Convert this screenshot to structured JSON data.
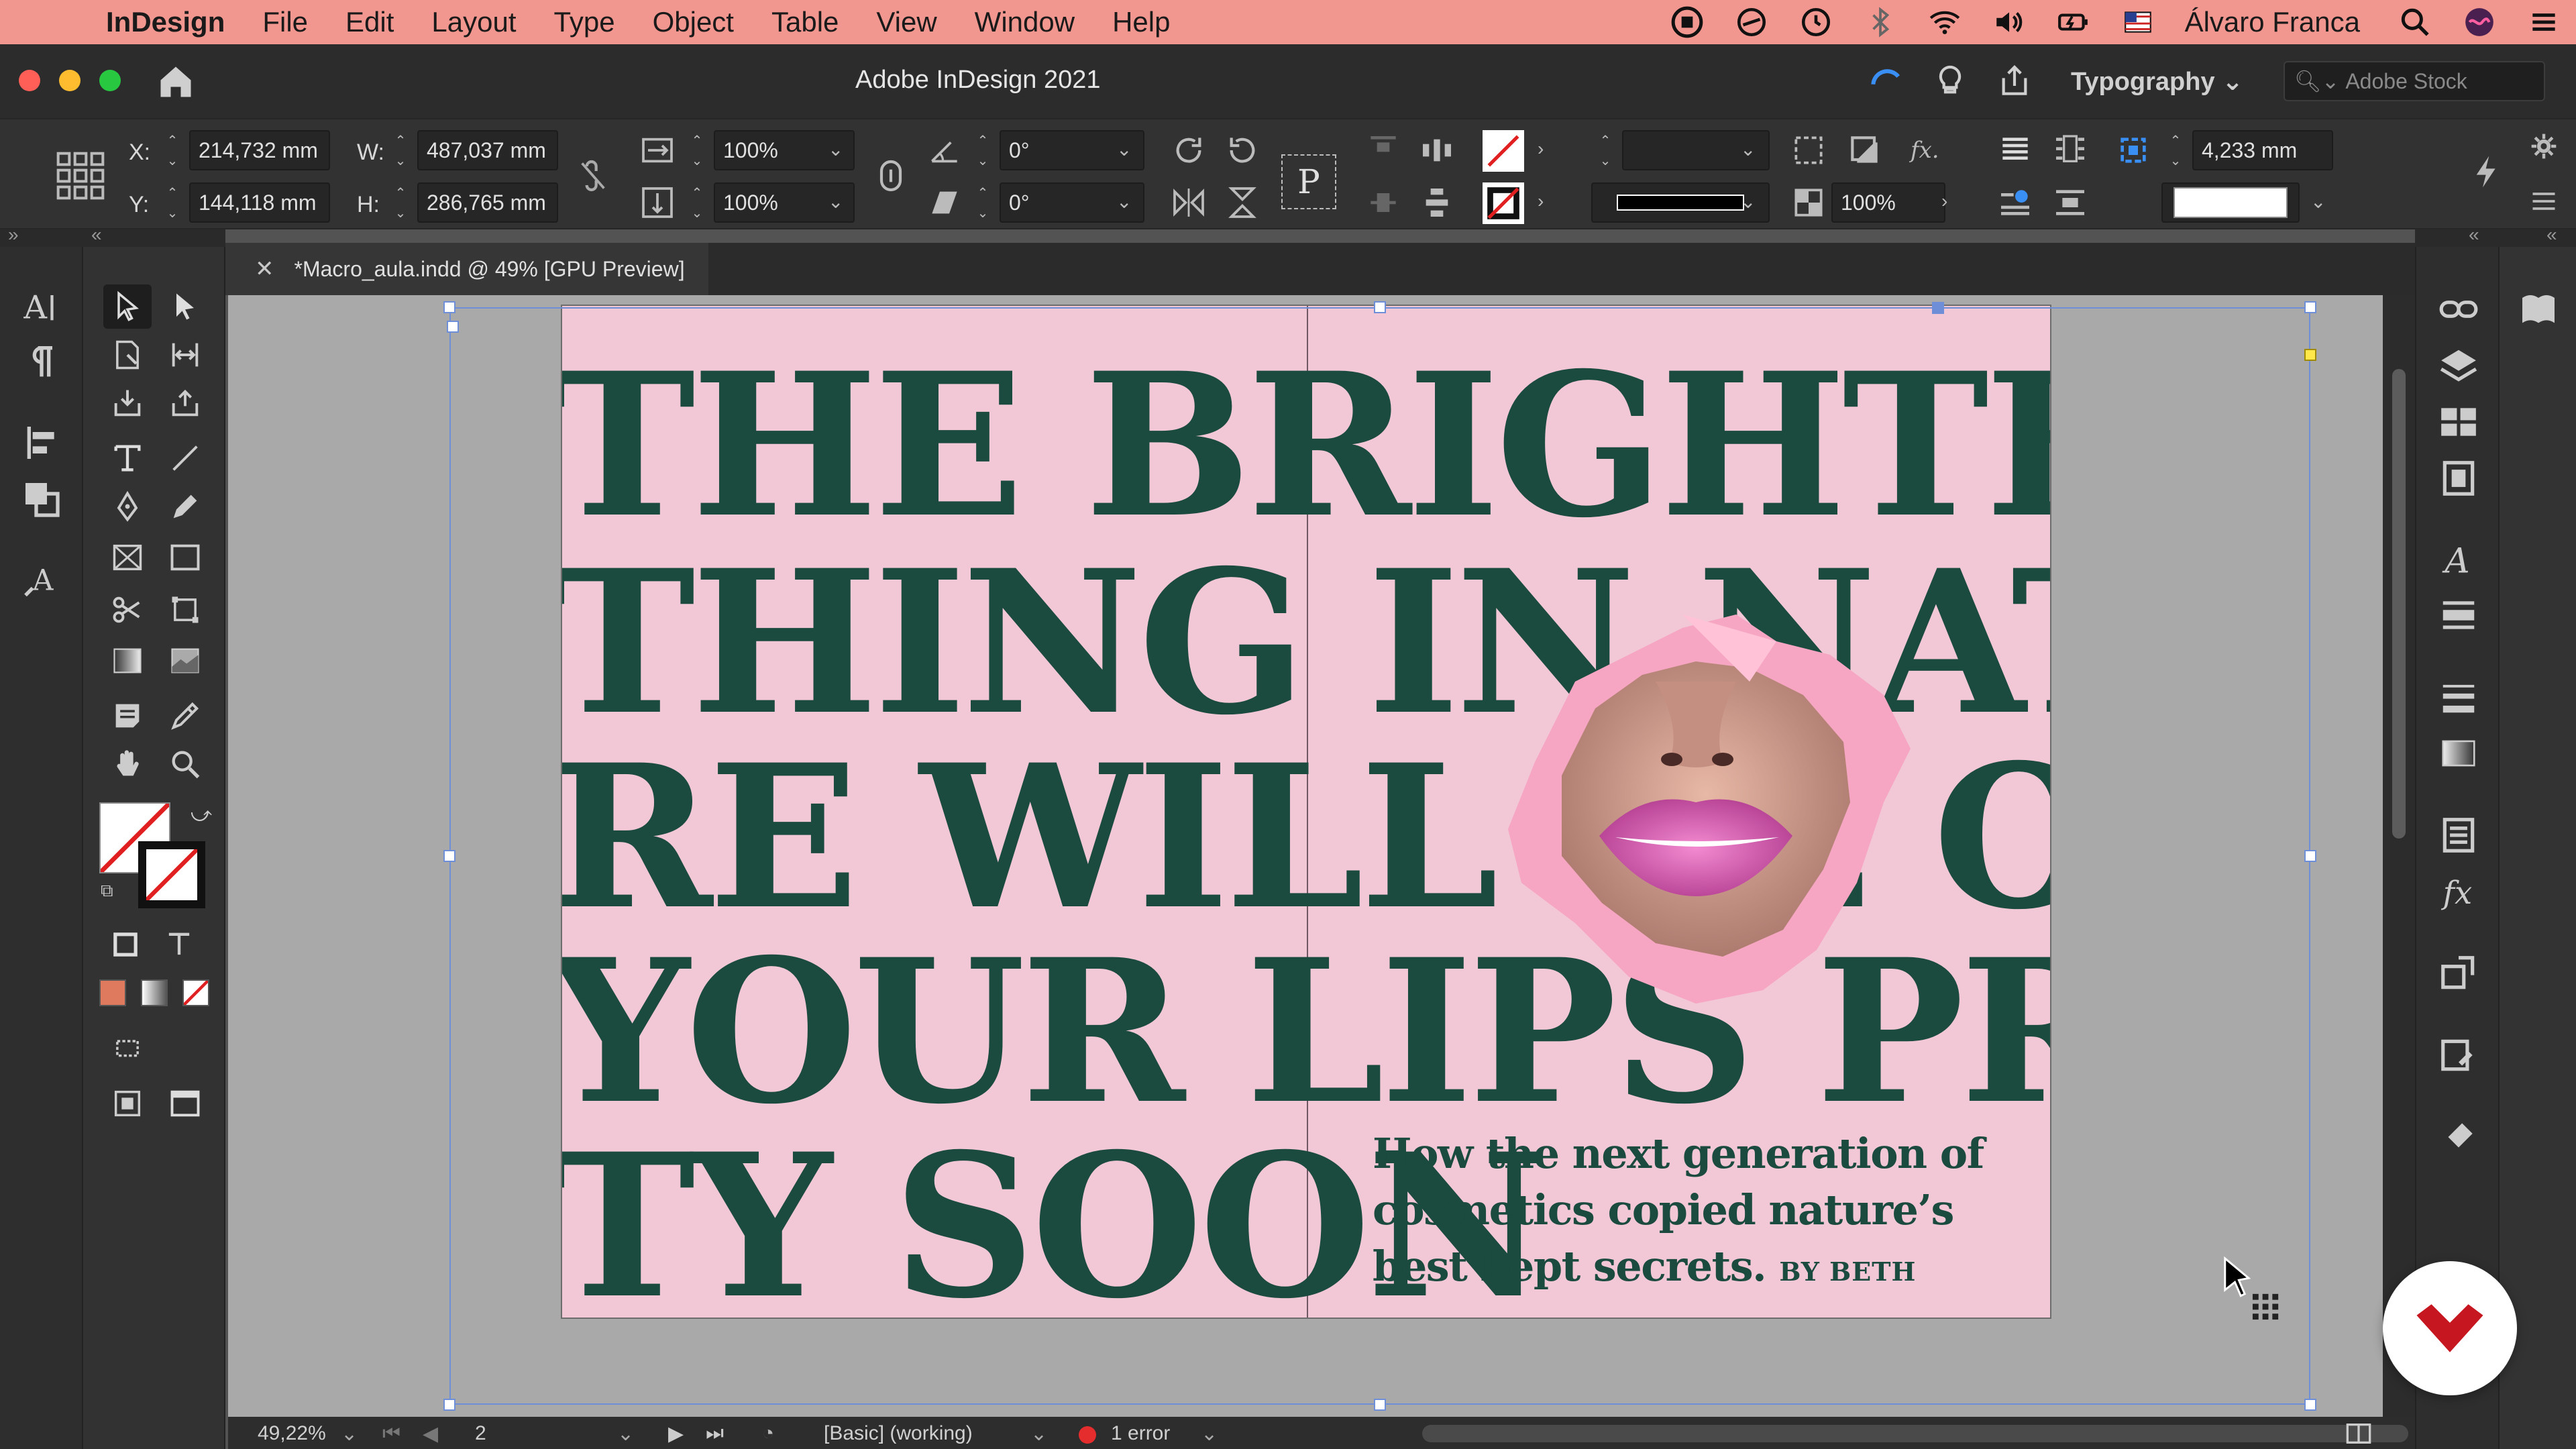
{
  "menubar": {
    "app": "InDesign",
    "items": [
      "File",
      "Edit",
      "Layout",
      "Type",
      "Object",
      "Table",
      "View",
      "Window",
      "Help"
    ],
    "user": "Álvaro Franca"
  },
  "titlebar": {
    "title": "Adobe InDesign 2021",
    "workspace": "Typography",
    "stock_placeholder": "Adobe Stock"
  },
  "control": {
    "x_label": "X:",
    "x_value": "214,732 mm",
    "y_label": "Y:",
    "y_value": "144,118 mm",
    "w_label": "W:",
    "w_value": "487,037 mm",
    "h_label": "H:",
    "h_value": "286,765 mm",
    "scale_x": "100%",
    "scale_y": "100%",
    "rotate": "0°",
    "shear": "0°",
    "opacity": "100%",
    "gap": "4,233 mm"
  },
  "document": {
    "tab_label": "*Macro_aula.indd @ 49% [GPU Preview]",
    "headline_lines": [
      "THE BRIGHTEST",
      "THING IN NATUR",
      "RE WILL BE ON",
      "YOUR LIPS PRET",
      "TY SOON"
    ],
    "subdeck": "How the next generation of cosmetics copied nature’s best kept secrets.",
    "byline": "BY BETH CARSON"
  },
  "statusbar": {
    "zoom": "49,22%",
    "page": "2",
    "style": "[Basic] (working)",
    "errors": "1 error"
  },
  "colors": {
    "menubar": "#f2978f",
    "page_bg": "#f2c7d6",
    "headline": "#1b4a3f",
    "selection": "#6e8fd8"
  }
}
